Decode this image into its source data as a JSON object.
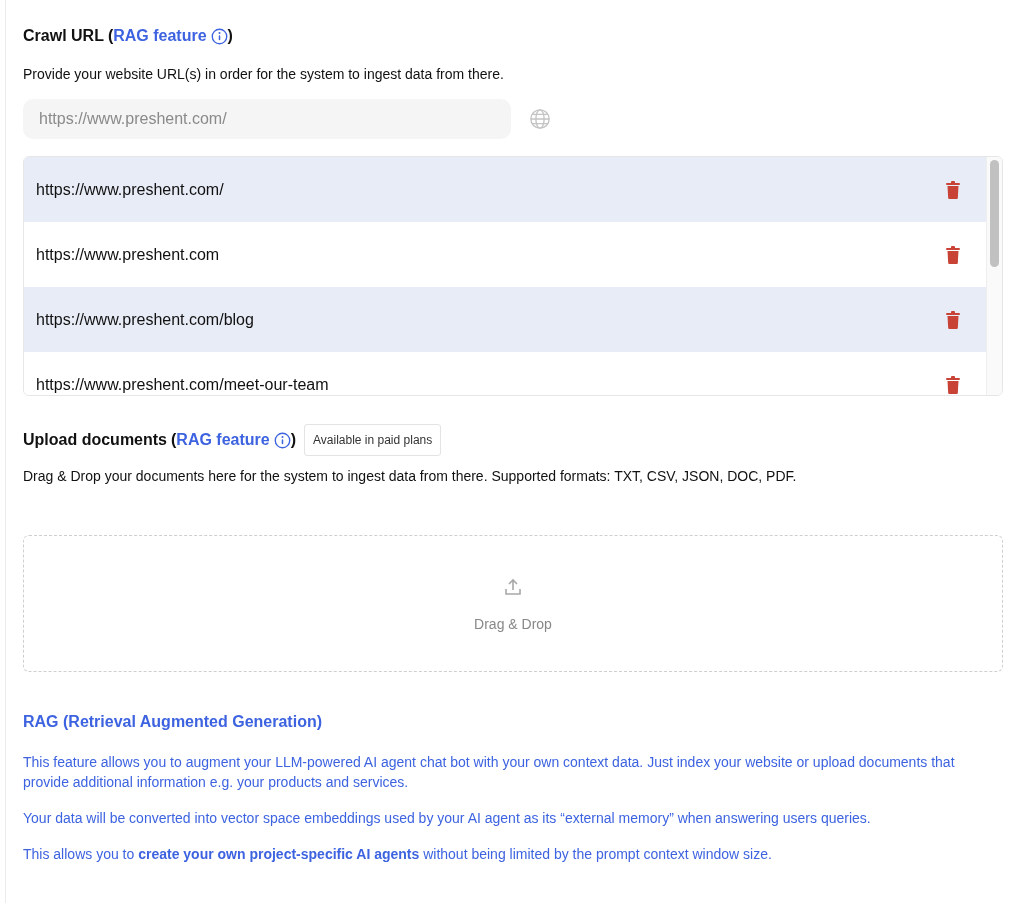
{
  "crawl": {
    "title": "Crawl URL",
    "open_paren": "(",
    "link": "RAG feature",
    "close_paren": ")",
    "description": "Provide your website URL(s) in order for the system to ingest data from there.",
    "url_field": {
      "placeholder": "https://www.preshent.com/"
    },
    "urls": [
      {
        "url": "https://www.preshent.com/"
      },
      {
        "url": "https://www.preshent.com"
      },
      {
        "url": "https://www.preshent.com/blog"
      },
      {
        "url": "https://www.preshent.com/meet-our-team"
      }
    ]
  },
  "upload": {
    "title": "Upload documents",
    "open_paren": "(",
    "link": "RAG feature",
    "close_paren": ")",
    "badge": "Available in paid plans",
    "description": "Drag & Drop your documents here for the system to ingest data from there. Supported formats: TXT, CSV, JSON, DOC, PDF.",
    "dropzone_label": "Drag & Drop"
  },
  "rag_info": {
    "title": "RAG (Retrieval Augmented Generation)",
    "paragraphs": [
      "This feature allows you to augment your LLM-powered AI agent chat bot with your own context data. Just index your website or upload documents that provide additional information e.g. your products and services.",
      "Your data will be converted into vector space embeddings used by your AI agent as its “external memory” when answering users queries.",
      "This allows you to **create your own project-specific AI agents** without being limited by the prompt context window size."
    ]
  }
}
